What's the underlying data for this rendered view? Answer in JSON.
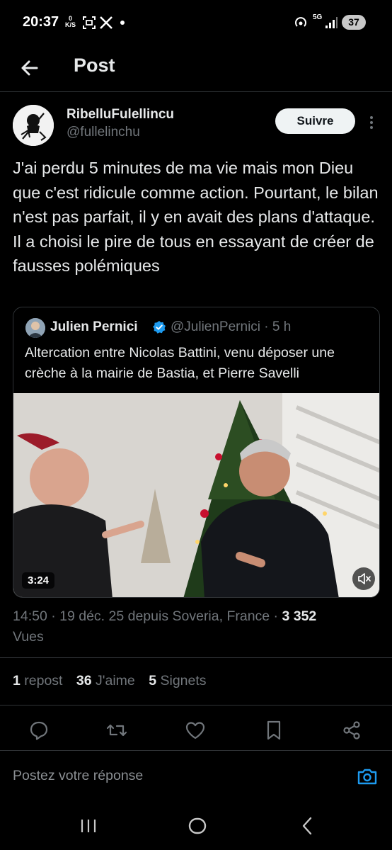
{
  "status_bar": {
    "time": "20:37",
    "speed_value": "0",
    "speed_unit": "K/S",
    "network": "5G",
    "battery": "37"
  },
  "header": {
    "title": "Post",
    "back_icon": "arrow-left-icon"
  },
  "author": {
    "name": "RibelluFulellincu",
    "handle": "@fullelinchu",
    "follow_label": "Suivre"
  },
  "tweet": {
    "text": "J'ai perdu 5 minutes de ma vie mais mon Dieu que c'est ridicule comme action. Pourtant, le bilan n'est pas parfait, il y en avait des plans d'attaque. Il a choisi le pire de tous en essayant de créer de fausses polémiques"
  },
  "quote": {
    "name": "Julien Pernici",
    "handle": "@JulienPernici · 5 h",
    "text": "Altercation entre Nicolas Battini, venu déposer une crèche à la mairie de Bastia, et Pierre Savelli",
    "video_duration": "3:24",
    "verified_color": "#1d9bf0"
  },
  "meta": {
    "time_date": "14:50 · 19 déc. 25 depuis Soveria, France · ",
    "views_count": "3 352",
    "views_label": "Vues"
  },
  "stats": {
    "reposts_count": "1",
    "reposts_label": "repost",
    "likes_count": "36",
    "likes_label": "J'aime",
    "bookmarks_count": "5",
    "bookmarks_label": "Signets"
  },
  "reply": {
    "placeholder": "Postez votre réponse"
  },
  "colors": {
    "accent": "#1d9bf0",
    "background": "#000000",
    "muted": "#71767b"
  }
}
